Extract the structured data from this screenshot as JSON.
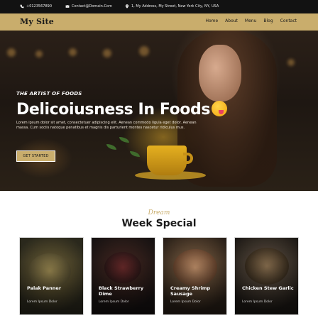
{
  "topbar": {
    "phone": "+0123567890",
    "email": "Contact@Domain.Com",
    "address": "1, My Address, My Street, New York City, NY, USA"
  },
  "nav": {
    "logo": "My Site",
    "items": [
      "Home",
      "About",
      "Menu",
      "Blog",
      "Contact"
    ]
  },
  "hero": {
    "tagline": "THE ARTIST OF FOODS",
    "headline": "Delicoiusness In Foods",
    "description": "Lorem ipsum dolor sit amet, consectetuer adipiscing elit. Aenean commodo ligula eget dolor. Aenean massa. Cum sociis natoque penatibus et magnis dis parturient montes nascetur ridiculus mus.",
    "cta_label": "GET STARTED"
  },
  "special": {
    "script_label": "Dream",
    "title": "Week Special",
    "cards": [
      {
        "name": "Palak Panner",
        "sub": "Lorem Ipsum Dolor"
      },
      {
        "name": "Black Strawberry Dime",
        "sub": "Lorem Ipsum Dolor"
      },
      {
        "name": "Creamy Shrimp Sausage",
        "sub": "Lorem Ipsum Dolor"
      },
      {
        "name": "Chicken Stew Garlic",
        "sub": "Lorem Ipsum Dolor"
      }
    ]
  },
  "colors": {
    "accent": "#c9ad6c",
    "topbar": "#121212",
    "text": "#1a1a1a"
  }
}
